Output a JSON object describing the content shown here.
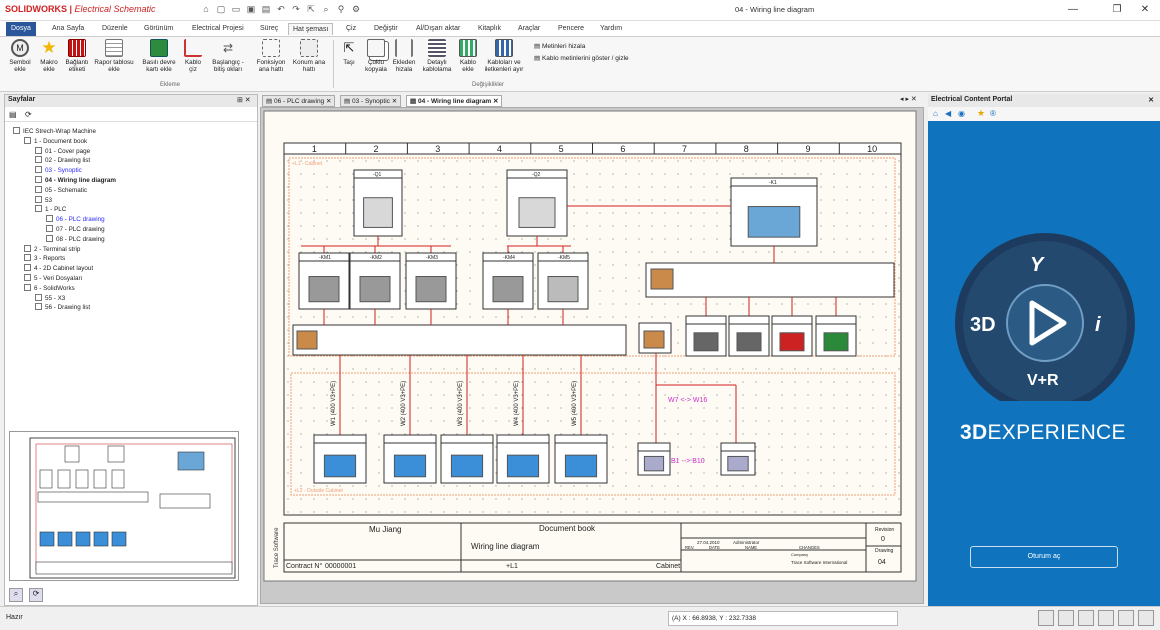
{
  "app": {
    "brand": "SOLIDWORKS",
    "brand_product": "Electrical Schematic",
    "window_title": "04 - Wiring line diagram"
  },
  "menu_tabs": [
    "Dosya",
    "Ana Sayfa",
    "Düzenle",
    "Görünüm",
    "Electrical Projesi",
    "Süreç",
    "Hat şeması",
    "Çiz",
    "Değiştir",
    "Al/Dışarı aktar",
    "Kitaplık",
    "Araçlar",
    "Pencere",
    "Yardım"
  ],
  "ribbon": {
    "buttons": [
      {
        "label": "Sembol ekle"
      },
      {
        "label": "Makro ekle"
      },
      {
        "label": "Bağlantı etiketi"
      },
      {
        "label": "Rapor tablosu ekle"
      },
      {
        "label": "Basılı devre kartı ekle"
      },
      {
        "label": "Kablo çiz"
      },
      {
        "label": "Başlangıç - bitiş okları"
      },
      {
        "label": "Fonksiyon ana hattı"
      },
      {
        "label": "Konum ana hattı"
      },
      {
        "label": "Taşı"
      },
      {
        "label": "Çoklu kopyala"
      },
      {
        "label": "Ekleden hizala"
      },
      {
        "label": "Detaylı kablolama"
      },
      {
        "label": "Kablo ekle"
      },
      {
        "label": "Kabloları ve iletkenleri ayır"
      }
    ],
    "small_items": [
      "Metinleri hizala",
      "Kablo metinlerini göster / gizle"
    ],
    "groups": [
      "Ekleme",
      "Değişiklikler"
    ]
  },
  "left_panel": {
    "title": "Sayfalar",
    "tree": [
      {
        "label": "IEC Strech-Wrap Machine",
        "level": 0,
        "style": "bold"
      },
      {
        "label": "1 - Document book",
        "level": 1
      },
      {
        "label": "01 - Cover page",
        "level": 2
      },
      {
        "label": "02 - Drawing list",
        "level": 2
      },
      {
        "label": "03 - Synoptic",
        "level": 2,
        "style": "blue"
      },
      {
        "label": "04 - Wiring line diagram",
        "level": 2,
        "style": "sel"
      },
      {
        "label": "05 - Schematic",
        "level": 2
      },
      {
        "label": "53",
        "level": 2
      },
      {
        "label": "1 - PLC",
        "level": 2
      },
      {
        "label": "06 - PLC drawing",
        "level": 3,
        "style": "blue"
      },
      {
        "label": "07 - PLC drawing",
        "level": 3
      },
      {
        "label": "08 - PLC drawing",
        "level": 3
      },
      {
        "label": "2 - Terminal strip",
        "level": 1
      },
      {
        "label": "3 - Reports",
        "level": 1
      },
      {
        "label": "4 - 2D Cabinet layout",
        "level": 1
      },
      {
        "label": "5 - Veri Dosyaları",
        "level": 1
      },
      {
        "label": "6 - SolidWorks",
        "level": 1
      },
      {
        "label": "55 - X3",
        "level": 2
      },
      {
        "label": "56 - Drawing list",
        "level": 2
      }
    ]
  },
  "doc_tabs": [
    {
      "label": "06 - PLC drawing"
    },
    {
      "label": "03 - Synoptic"
    },
    {
      "label": "04 - Wiring line diagram",
      "active": true
    }
  ],
  "drawing": {
    "columns": [
      "1",
      "2",
      "3",
      "4",
      "5",
      "6",
      "7",
      "8",
      "9",
      "10"
    ],
    "zone_top": "+L1 - Cabinet",
    "zone_bottom": "+L2 - Outside Cabinet",
    "arrow_a": "W7 <-> W16",
    "arrow_b": "B1 --> B10",
    "top_devices": [
      "-Q1",
      "-Q2",
      "-K1"
    ],
    "mid_devices": [
      "-KM1",
      "-KM2",
      "-KM3",
      "-KM4",
      "-KM5"
    ],
    "cables": [
      "W1 (400 V3+PE)",
      "W2 (400 V3+PE)",
      "W3 (400 V3+PE)",
      "W4 (400 V3+PE)",
      "W5 (400 V3+PE)"
    ],
    "titleblock": {
      "author": "Mu Jiang",
      "book": "Document book",
      "sheet_title": "Wiring line diagram",
      "contract_label": "Contract N°",
      "contract": "00000001",
      "location": "+L1",
      "cabinet": "Cabinet",
      "revision_label": "Revision",
      "revision": "0",
      "drawing_label": "Drawing",
      "drawing": "04",
      "date": "27.04.2010",
      "editor": "Administrator",
      "headers": [
        "REV.",
        "DATE",
        "NAME",
        "CHANGES"
      ],
      "company_label": "Company",
      "company": "Trace Software International",
      "software_mark": "Trace Software"
    }
  },
  "right_panel": {
    "title": "Electrical Content Portal",
    "logo_items": [
      "3D",
      "V+R"
    ],
    "experience_bold": "3D",
    "experience_rest": "EXPERIENCE",
    "ok_button": "Oturum aç"
  },
  "status": {
    "left": "Hazır",
    "coords": "(A) X : 66.8938, Y : 232.7338"
  },
  "colors": {
    "accent": "#2b579a",
    "portal_blue": "#0f74bd",
    "wire_red": "#d22222",
    "zone_orange": "#f0a07a",
    "arrow_magenta": "#cc2ecc"
  }
}
